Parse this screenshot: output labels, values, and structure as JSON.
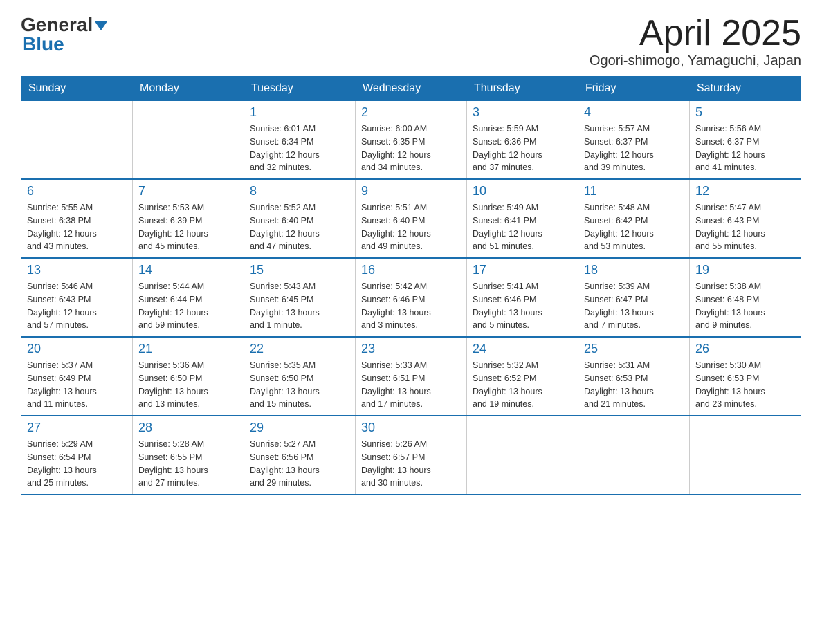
{
  "header": {
    "logo_general": "General",
    "logo_blue": "Blue",
    "month_title": "April 2025",
    "location": "Ogori-shimogo, Yamaguchi, Japan"
  },
  "weekdays": [
    "Sunday",
    "Monday",
    "Tuesday",
    "Wednesday",
    "Thursday",
    "Friday",
    "Saturday"
  ],
  "weeks": [
    [
      {
        "day": "",
        "info": ""
      },
      {
        "day": "",
        "info": ""
      },
      {
        "day": "1",
        "info": "Sunrise: 6:01 AM\nSunset: 6:34 PM\nDaylight: 12 hours\nand 32 minutes."
      },
      {
        "day": "2",
        "info": "Sunrise: 6:00 AM\nSunset: 6:35 PM\nDaylight: 12 hours\nand 34 minutes."
      },
      {
        "day": "3",
        "info": "Sunrise: 5:59 AM\nSunset: 6:36 PM\nDaylight: 12 hours\nand 37 minutes."
      },
      {
        "day": "4",
        "info": "Sunrise: 5:57 AM\nSunset: 6:37 PM\nDaylight: 12 hours\nand 39 minutes."
      },
      {
        "day": "5",
        "info": "Sunrise: 5:56 AM\nSunset: 6:37 PM\nDaylight: 12 hours\nand 41 minutes."
      }
    ],
    [
      {
        "day": "6",
        "info": "Sunrise: 5:55 AM\nSunset: 6:38 PM\nDaylight: 12 hours\nand 43 minutes."
      },
      {
        "day": "7",
        "info": "Sunrise: 5:53 AM\nSunset: 6:39 PM\nDaylight: 12 hours\nand 45 minutes."
      },
      {
        "day": "8",
        "info": "Sunrise: 5:52 AM\nSunset: 6:40 PM\nDaylight: 12 hours\nand 47 minutes."
      },
      {
        "day": "9",
        "info": "Sunrise: 5:51 AM\nSunset: 6:40 PM\nDaylight: 12 hours\nand 49 minutes."
      },
      {
        "day": "10",
        "info": "Sunrise: 5:49 AM\nSunset: 6:41 PM\nDaylight: 12 hours\nand 51 minutes."
      },
      {
        "day": "11",
        "info": "Sunrise: 5:48 AM\nSunset: 6:42 PM\nDaylight: 12 hours\nand 53 minutes."
      },
      {
        "day": "12",
        "info": "Sunrise: 5:47 AM\nSunset: 6:43 PM\nDaylight: 12 hours\nand 55 minutes."
      }
    ],
    [
      {
        "day": "13",
        "info": "Sunrise: 5:46 AM\nSunset: 6:43 PM\nDaylight: 12 hours\nand 57 minutes."
      },
      {
        "day": "14",
        "info": "Sunrise: 5:44 AM\nSunset: 6:44 PM\nDaylight: 12 hours\nand 59 minutes."
      },
      {
        "day": "15",
        "info": "Sunrise: 5:43 AM\nSunset: 6:45 PM\nDaylight: 13 hours\nand 1 minute."
      },
      {
        "day": "16",
        "info": "Sunrise: 5:42 AM\nSunset: 6:46 PM\nDaylight: 13 hours\nand 3 minutes."
      },
      {
        "day": "17",
        "info": "Sunrise: 5:41 AM\nSunset: 6:46 PM\nDaylight: 13 hours\nand 5 minutes."
      },
      {
        "day": "18",
        "info": "Sunrise: 5:39 AM\nSunset: 6:47 PM\nDaylight: 13 hours\nand 7 minutes."
      },
      {
        "day": "19",
        "info": "Sunrise: 5:38 AM\nSunset: 6:48 PM\nDaylight: 13 hours\nand 9 minutes."
      }
    ],
    [
      {
        "day": "20",
        "info": "Sunrise: 5:37 AM\nSunset: 6:49 PM\nDaylight: 13 hours\nand 11 minutes."
      },
      {
        "day": "21",
        "info": "Sunrise: 5:36 AM\nSunset: 6:50 PM\nDaylight: 13 hours\nand 13 minutes."
      },
      {
        "day": "22",
        "info": "Sunrise: 5:35 AM\nSunset: 6:50 PM\nDaylight: 13 hours\nand 15 minutes."
      },
      {
        "day": "23",
        "info": "Sunrise: 5:33 AM\nSunset: 6:51 PM\nDaylight: 13 hours\nand 17 minutes."
      },
      {
        "day": "24",
        "info": "Sunrise: 5:32 AM\nSunset: 6:52 PM\nDaylight: 13 hours\nand 19 minutes."
      },
      {
        "day": "25",
        "info": "Sunrise: 5:31 AM\nSunset: 6:53 PM\nDaylight: 13 hours\nand 21 minutes."
      },
      {
        "day": "26",
        "info": "Sunrise: 5:30 AM\nSunset: 6:53 PM\nDaylight: 13 hours\nand 23 minutes."
      }
    ],
    [
      {
        "day": "27",
        "info": "Sunrise: 5:29 AM\nSunset: 6:54 PM\nDaylight: 13 hours\nand 25 minutes."
      },
      {
        "day": "28",
        "info": "Sunrise: 5:28 AM\nSunset: 6:55 PM\nDaylight: 13 hours\nand 27 minutes."
      },
      {
        "day": "29",
        "info": "Sunrise: 5:27 AM\nSunset: 6:56 PM\nDaylight: 13 hours\nand 29 minutes."
      },
      {
        "day": "30",
        "info": "Sunrise: 5:26 AM\nSunset: 6:57 PM\nDaylight: 13 hours\nand 30 minutes."
      },
      {
        "day": "",
        "info": ""
      },
      {
        "day": "",
        "info": ""
      },
      {
        "day": "",
        "info": ""
      }
    ]
  ]
}
